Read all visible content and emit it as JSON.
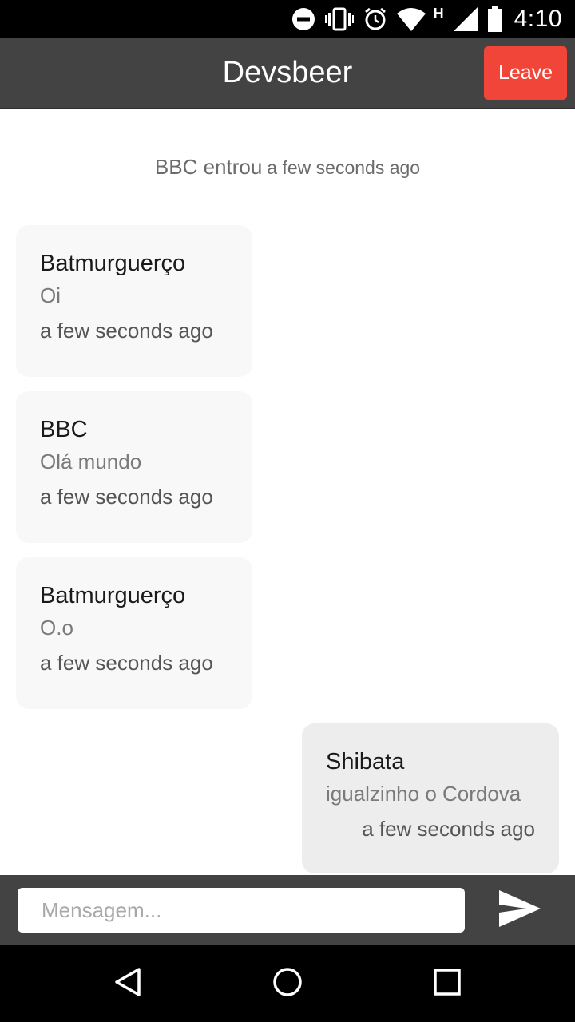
{
  "status_bar": {
    "time": "4:10",
    "network_type": "H",
    "icons": [
      "do-not-disturb-icon",
      "vibrate-icon",
      "alarm-icon",
      "wifi-icon",
      "cell-signal-icon",
      "battery-icon"
    ]
  },
  "header": {
    "title": "Devsbeer",
    "leave_label": "Leave",
    "leave_color": "#f04538",
    "bar_color": "#434343"
  },
  "system_message": {
    "text": "BBC entrou",
    "time": "a few seconds ago"
  },
  "messages": [
    {
      "author": "Batmurguerço",
      "text": "Oi",
      "time": "a few seconds ago",
      "side": "left"
    },
    {
      "author": "BBC",
      "text": "Olá mundo",
      "time": "a few seconds ago",
      "side": "left"
    },
    {
      "author": "Batmurguerço",
      "text": "O.o",
      "time": "a few seconds ago",
      "side": "left"
    },
    {
      "author": "Shibata",
      "text": "igualzinho o Cordova",
      "time": "a few seconds ago",
      "side": "right"
    }
  ],
  "composer": {
    "placeholder": "Mensagem...",
    "value": "",
    "send_icon": "send-icon"
  },
  "nav_bar": {
    "icons": [
      "back-icon",
      "home-icon",
      "recents-icon"
    ]
  }
}
